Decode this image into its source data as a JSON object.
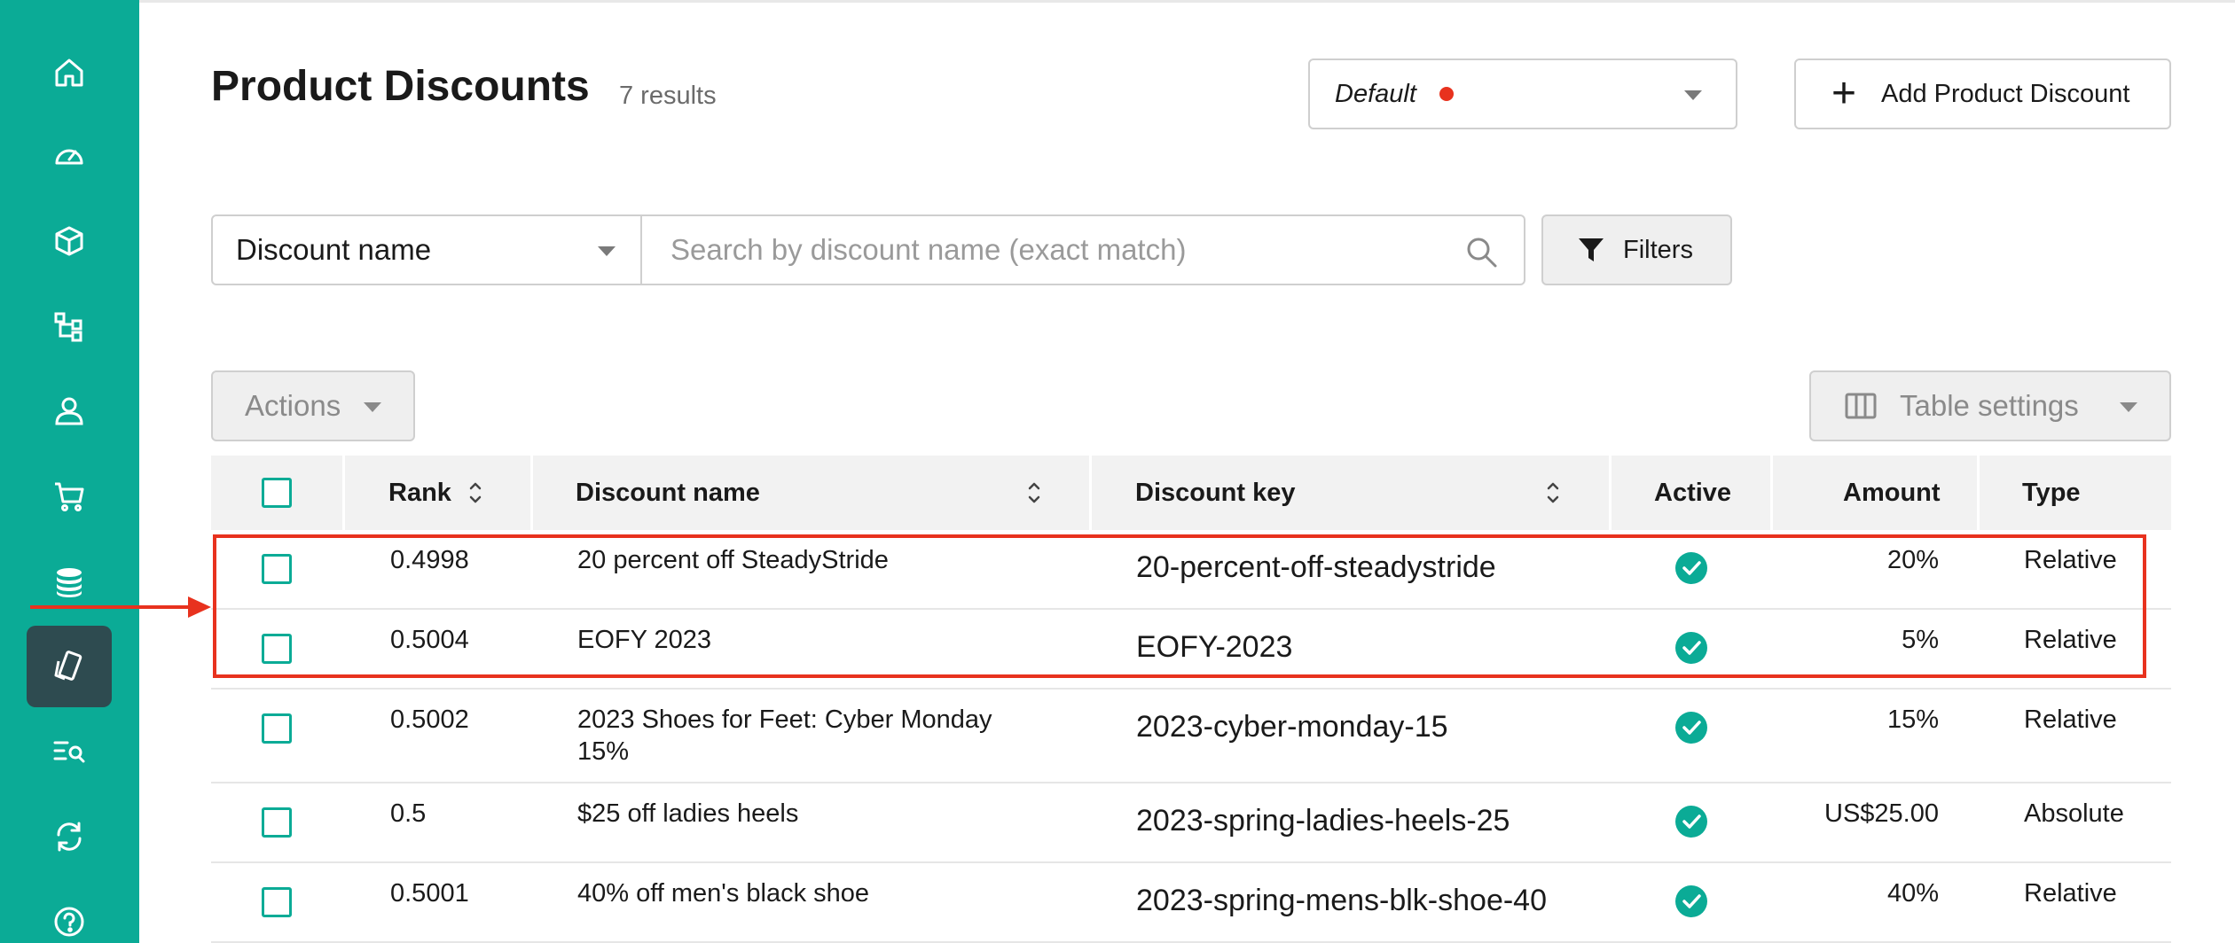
{
  "header": {
    "title": "Product Discounts",
    "result_count": "7 results",
    "store_select": {
      "value": "Default",
      "indicator_color": "#e8321e"
    },
    "add_button_label": "Add Product Discount"
  },
  "search": {
    "field_selected": "Discount name",
    "placeholder": "Search by discount name (exact match)",
    "filters_label": "Filters"
  },
  "toolbar": {
    "actions_label": "Actions",
    "table_settings_label": "Table settings"
  },
  "table": {
    "columns": {
      "rank": "Rank",
      "name": "Discount name",
      "key": "Discount key",
      "active": "Active",
      "amount": "Amount",
      "type": "Type"
    },
    "rows": [
      {
        "rank": "0.4998",
        "name": "20 percent off SteadyStride",
        "key": "20-percent-off-steadystride",
        "amount": "20%",
        "type": "Relative"
      },
      {
        "rank": "0.5004",
        "name": "EOFY 2023",
        "key": "EOFY-2023",
        "amount": "5%",
        "type": "Relative"
      },
      {
        "rank": "0.5002",
        "name_line1": "2023 Shoes for Feet: Cyber Monday",
        "name_line2": "15%",
        "key": "2023-cyber-monday-15",
        "amount": "15%",
        "type": "Relative"
      },
      {
        "rank": "0.5",
        "name": "$25 off ladies heels",
        "key": "2023-spring-ladies-heels-25",
        "amount": "US$25.00",
        "type": "Absolute"
      },
      {
        "rank": "0.5001",
        "name": "40% off men's black shoe",
        "key": "2023-spring-mens-blk-shoe-40",
        "amount": "40%",
        "type": "Relative"
      }
    ]
  },
  "sidebar": {
    "items": [
      {
        "icon": "home-icon"
      },
      {
        "icon": "dashboard-icon"
      },
      {
        "icon": "products-cube-icon"
      },
      {
        "icon": "categories-icon"
      },
      {
        "icon": "customers-icon"
      },
      {
        "icon": "orders-cart-icon"
      },
      {
        "icon": "prices-coins-icon"
      },
      {
        "icon": "discounts-icon",
        "active": true
      },
      {
        "icon": "search-list-icon"
      },
      {
        "icon": "sync-icon"
      },
      {
        "icon": "help-icon"
      }
    ]
  },
  "colors": {
    "sidebar": "#0bab96",
    "sidebar_active": "#2e4b50",
    "annotation": "#e8321e",
    "accent": "#0bab96"
  }
}
